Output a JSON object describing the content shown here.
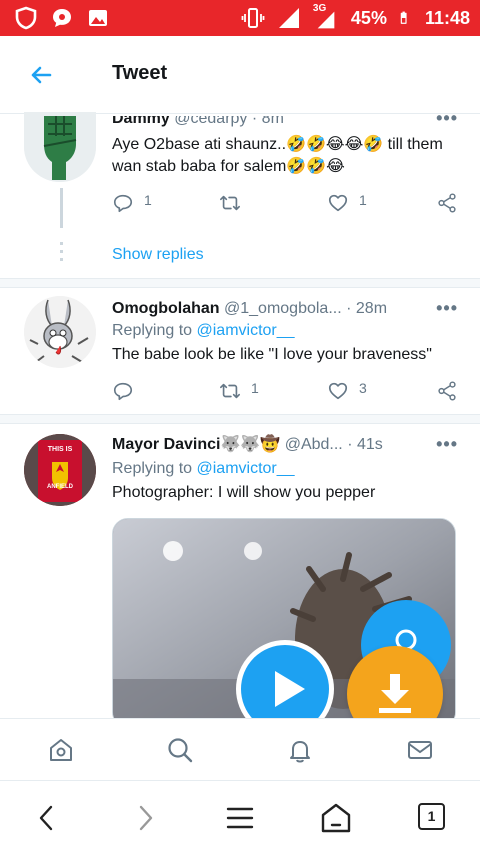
{
  "status_bar": {
    "battery": "45%",
    "time": "11:48",
    "network": "3G"
  },
  "header": {
    "title": "Tweet"
  },
  "tweets": [
    {
      "name": "Dammy",
      "handle": "@cedarpy",
      "time": "8m",
      "text": "Aye O2base ati shaunz..🤣🤣😂😂🤣 till them wan stab baba for salem🤣🤣😂",
      "reply_count": "1",
      "retweet_count": "",
      "like_count": "1",
      "show_replies": "Show replies",
      "avatar_icon": "raised-fist-icon"
    },
    {
      "name": "Omogbolahan",
      "handle": "@1_omogbola...",
      "time": "28m",
      "replying_prefix": "Replying to",
      "replying_to": "@iamvictor__",
      "text": "The babe look be like \"I love your braveness\"",
      "reply_count": "",
      "retweet_count": "1",
      "like_count": "3",
      "avatar_icon": "cartoon-rabbit-icon"
    },
    {
      "name": "Mayor Davinci🐺🐺🤠",
      "handle": "@Abd...",
      "time": "41s",
      "replying_prefix": "Replying to",
      "replying_to": "@iamvictor__",
      "text": "Photographer: I will show you pepper",
      "avatar_icon": "this-is-anfield-sign-icon",
      "avatar_text_top": "THIS IS",
      "avatar_text_bottom": "ANFIELD"
    }
  ],
  "colors": {
    "status_bar": "#e8262a",
    "accent": "#1da1f2",
    "download_fab": "#f4a41c",
    "secondary_text": "#657786"
  },
  "tab_bar": [
    "home-icon",
    "search-icon",
    "notifications-icon",
    "messages-icon"
  ],
  "browser_nav": {
    "tab_count": "1"
  }
}
